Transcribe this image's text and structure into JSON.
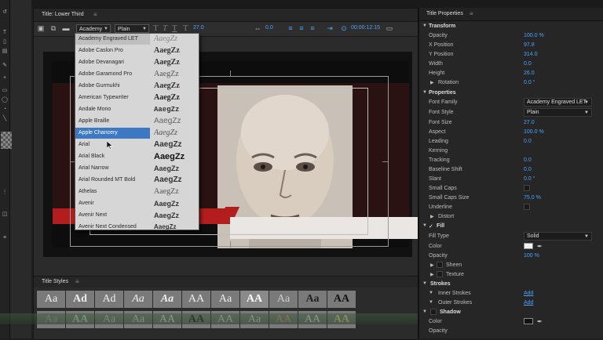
{
  "title_panel": {
    "tab_label": "Title: Lower Third",
    "menu_icon": "hamburger-menu-icon",
    "toolbar": {
      "font_family_value": "Academy",
      "font_style_value": "Plain",
      "font_size": "27.0",
      "kerning": "0.0",
      "timecode": "00:00:12:15"
    }
  },
  "font_dropdown": {
    "items": [
      {
        "name": "Academy Engraved LET",
        "sample": "AaegZz"
      },
      {
        "name": "Adobe Caslon Pro",
        "sample": "AaegZz"
      },
      {
        "name": "Adobe Devanagari",
        "sample": "AaegZz"
      },
      {
        "name": "Adobe Garamond Pro",
        "sample": "AaegZz"
      },
      {
        "name": "Adobe Gurmukhi",
        "sample": "AaegZz"
      },
      {
        "name": "American Typewriter",
        "sample": "AaegZz"
      },
      {
        "name": "Andale Mono",
        "sample": "AaegZz"
      },
      {
        "name": "Apple Braille",
        "sample": "AaegZz"
      },
      {
        "name": "Apple Chancery",
        "sample": "AaegZz"
      },
      {
        "name": "Arial",
        "sample": "AaegZz"
      },
      {
        "name": "Arial Black",
        "sample": "AaegZz"
      },
      {
        "name": "Arial Narrow",
        "sample": "AaegZz"
      },
      {
        "name": "Arial Rounded MT Bold",
        "sample": "AaegZz"
      },
      {
        "name": "Athelas",
        "sample": "AaegZz"
      },
      {
        "name": "Avenir",
        "sample": "AaegZz"
      },
      {
        "name": "Avenir Next",
        "sample": "AaegZz"
      },
      {
        "name": "Avenir Next Condensed",
        "sample": "AaegZz"
      }
    ],
    "selected_index": 8
  },
  "styles_panel": {
    "tab_label": "Title Styles",
    "row1": [
      "Aa",
      "Ad",
      "Ad",
      "Aa",
      "Aa",
      "AA",
      "Aa",
      "AA",
      "Aa",
      "Aa",
      "AA"
    ],
    "row2": [
      "Aa",
      "AA",
      "Aa",
      "Aa",
      "AA",
      "AA",
      "AA",
      "Aa",
      "AA",
      "AA",
      "AA"
    ]
  },
  "properties": {
    "tab_label": "Title Properties",
    "transform_label": "Transform",
    "opacity_label": "Opacity",
    "opacity": "100.0 %",
    "x_label": "X Position",
    "x": "97.8",
    "y_label": "Y Position",
    "y": "314.0",
    "width_label": "Width",
    "width": "0.0",
    "height_label": "Height",
    "height": "26.0",
    "rotation_label": "Rotation",
    "rotation": "0.0 °",
    "properties_label": "Properties",
    "font_family_label": "Font Family",
    "font_family": "Academy Engraved LET",
    "font_style_label": "Font Style",
    "font_style": "Plain",
    "font_size_label": "Font Size",
    "font_size": "27.0",
    "aspect_label": "Aspect",
    "aspect": "100.0 %",
    "leading_label": "Leading",
    "leading": "0.0",
    "kerning_label": "Kerning",
    "kerning": "",
    "tracking_label": "Tracking",
    "tracking": "0.0",
    "baseline_label": "Baseline Shift",
    "baseline": "0.0",
    "slant_label": "Slant",
    "slant": "0.0 °",
    "small_caps_label": "Small Caps",
    "small_caps_size_label": "Small Caps Size",
    "small_caps_size": "75.0 %",
    "underline_label": "Underline",
    "distort_label": "Distort",
    "fill_label": "Fill",
    "fill_type_label": "Fill Type",
    "fill_type": "Solid",
    "color_label": "Color",
    "fill_opacity_label": "Opacity",
    "fill_opacity": "100 %",
    "sheen_label": "Sheen",
    "texture_label": "Texture",
    "strokes_label": "Strokes",
    "inner_strokes_label": "Inner Strokes",
    "inner_add": "Add",
    "outer_strokes_label": "Outer Strokes",
    "outer_add": "Add",
    "shadow_label": "Shadow",
    "shadow_color_label": "Color",
    "shadow_opacity_label": "Opacity"
  },
  "colors": {
    "accent": "#4aa3ff",
    "selection": "#3c79c2",
    "lower_third_red": "#b31d1d",
    "lower_third_white": "#e9e6e3"
  }
}
